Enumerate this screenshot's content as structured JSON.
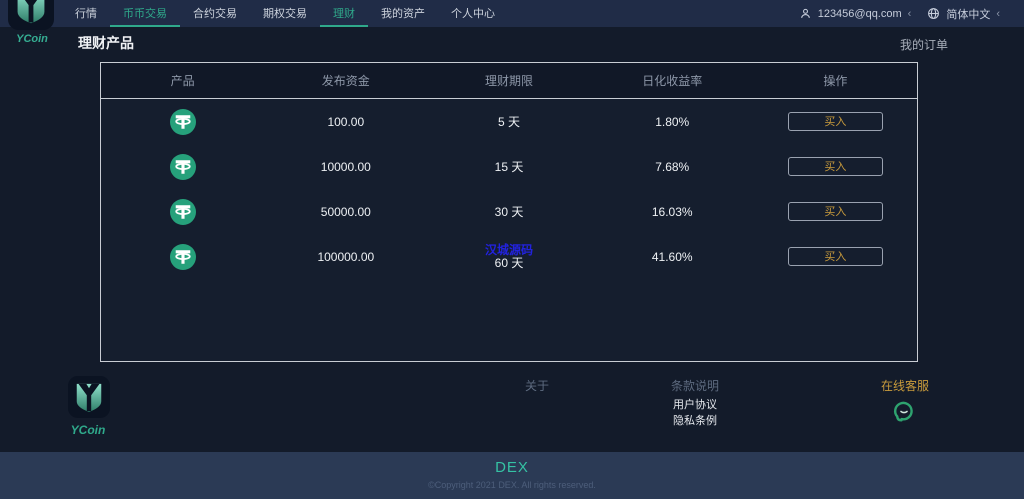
{
  "brand": {
    "name": "YCoin"
  },
  "navbar": {
    "items": [
      {
        "label": "行情",
        "active": false
      },
      {
        "label": "币币交易",
        "active": true
      },
      {
        "label": "合约交易",
        "active": false
      },
      {
        "label": "期权交易",
        "active": false
      },
      {
        "label": "理财",
        "active": true
      },
      {
        "label": "我的资产",
        "active": false
      },
      {
        "label": "个人中心",
        "active": false
      }
    ],
    "account": "123456@qq.com",
    "language": "简体中文",
    "chevron": "‹"
  },
  "page": {
    "title": "理财产品",
    "orders_link": "我的订单"
  },
  "table": {
    "headers": [
      "产品",
      "发布资金",
      "理财期限",
      "日化收益率",
      "操作"
    ],
    "buy_label": "买入",
    "rows": [
      {
        "product": "USDT",
        "amount": "100.00",
        "period": "5 天",
        "rate": "1.80%"
      },
      {
        "product": "USDT",
        "amount": "10000.00",
        "period": "15 天",
        "rate": "7.68%"
      },
      {
        "product": "USDT",
        "amount": "50000.00",
        "period": "30 天",
        "rate": "16.03%"
      },
      {
        "product": "USDT",
        "amount": "100000.00",
        "period": "60 天",
        "rate": "41.60%",
        "watermark": "汉城源码"
      }
    ]
  },
  "footer": {
    "about": "关于",
    "terms_title": "条款说明",
    "terms_link_user": "用户协议",
    "terms_link_privacy": "隐私条例",
    "service": "在线客服",
    "brand": "YCoin"
  },
  "bottom": {
    "brand": "DEX",
    "copyright": "©Copyright 2021 DEX. All rights reserved."
  },
  "colors": {
    "accent_teal": "#2fa98b",
    "gold": "#c89b3c",
    "tether_green": "#26a17b",
    "watermark_blue": "#2222dd",
    "navbar_bg": "#202c47",
    "page_bg": "#131b2a",
    "bottom_bar_bg": "#2b3a55"
  }
}
